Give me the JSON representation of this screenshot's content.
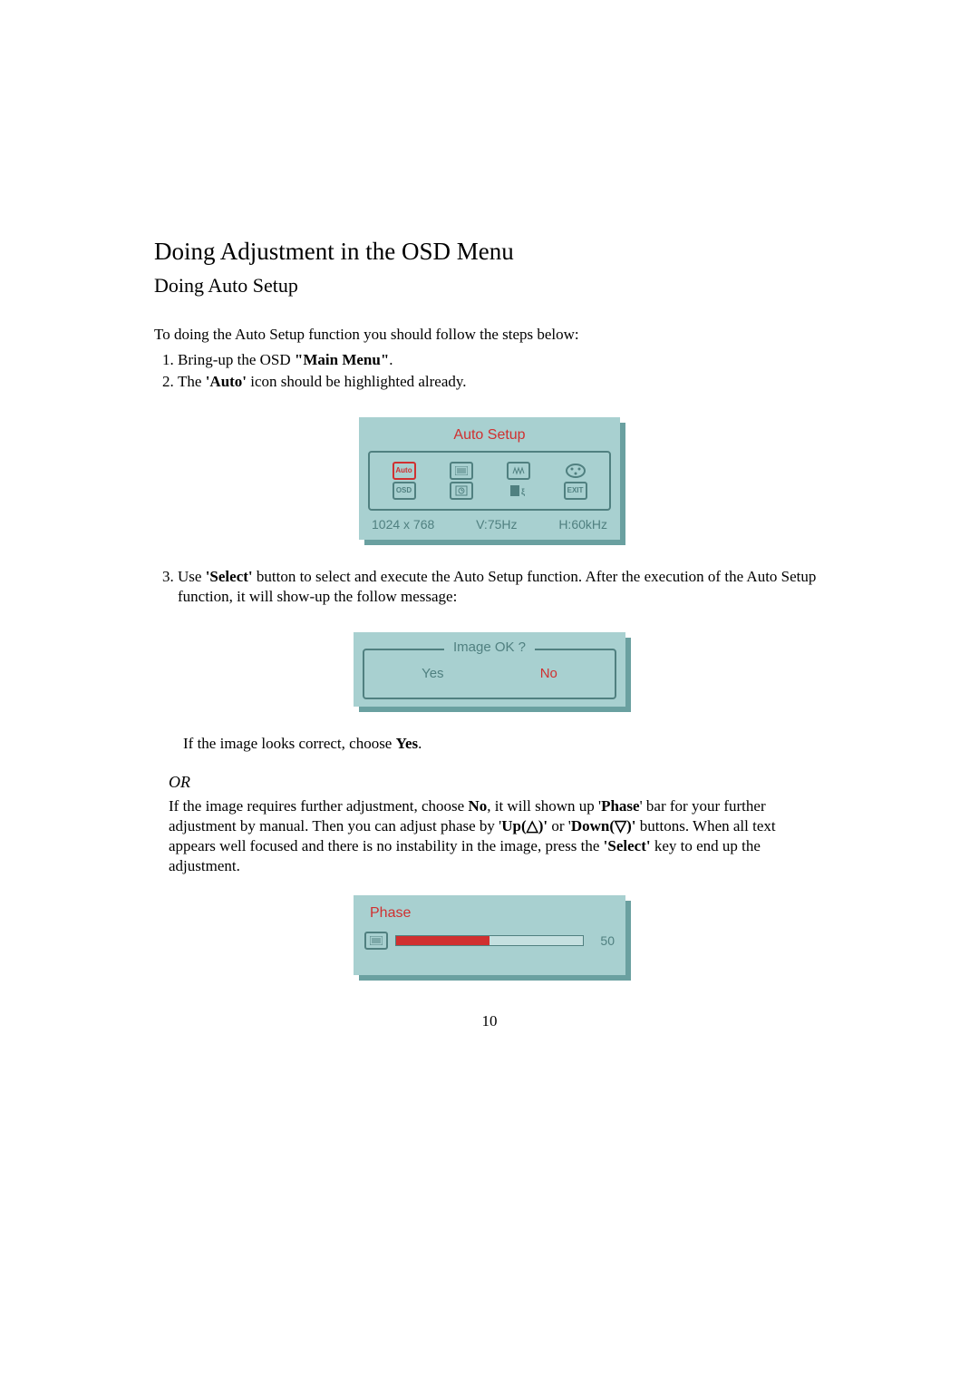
{
  "headings": {
    "h1": "Doing Adjustment in the OSD Menu",
    "h2": "Doing Auto Setup"
  },
  "intro": "To doing the Auto Setup function you should follow the steps below:",
  "steps": {
    "s1_a": "Bring-up the OSD ",
    "s1_b": "\"Main Menu\"",
    "s1_c": ".",
    "s2_a": "The ",
    "s2_b": "'Auto'",
    "s2_c": " icon should be highlighted already.",
    "s3_a": "Use ",
    "s3_b": "'Select'",
    "s3_c": " button to select and execute the Auto Setup function. After the execution of the Auto Setup function, it will show-up the follow message:"
  },
  "osd_main": {
    "title": "Auto Setup",
    "icons_row1": [
      "Auto",
      "menu",
      "wave",
      "color"
    ],
    "icons_row2": [
      "OSD",
      "clock",
      "lang",
      "EXIT"
    ],
    "status": {
      "res": "1024 x 768",
      "v": "V:75Hz",
      "h": "H:60kHz"
    }
  },
  "after3_a": "If the image looks correct, choose ",
  "after3_b": "Yes",
  "after3_c": ".",
  "or_label": "OR",
  "after_or": {
    "a": "If the image requires further adjustment, choose ",
    "no": "No",
    "b": ", it will shown up ",
    "phase_q1": "'",
    "phase": "Phase",
    "phase_q2": "'",
    "c": " bar for your further adjustment by manual. Then you can adjust phase by ",
    "up_q1": "'",
    "up": "Up(",
    "up_tri": "△",
    "up_close": ")'",
    "d": " or ",
    "down_q1": "'",
    "down": "Down(",
    "down_tri": "▽",
    "down_close": ")'",
    "e": " buttons. When all text appears well focused and there is no instability in the image, press the ",
    "select_q": "'Select'",
    "f": " key to end up the adjustment."
  },
  "osd_imageok": {
    "title": "Image OK ?",
    "yes": "Yes",
    "no": "No"
  },
  "osd_phase": {
    "title": "Phase",
    "value": "50"
  },
  "page_number": "10"
}
